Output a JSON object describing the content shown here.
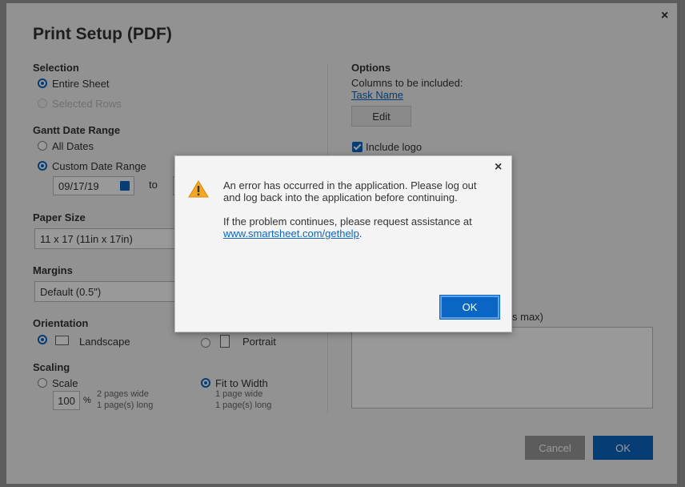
{
  "dialog": {
    "title": "Print Setup (PDF)",
    "selection": {
      "label": "Selection",
      "entire_sheet": "Entire Sheet",
      "selected_rows": "Selected Rows"
    },
    "gantt": {
      "label": "Gantt Date Range",
      "all_dates": "All Dates",
      "custom_range": "Custom Date Range",
      "start_date": "09/17/19",
      "to": "to"
    },
    "paper": {
      "label": "Paper Size",
      "value": "11 x 17 (11in x 17in)"
    },
    "margins": {
      "label": "Margins",
      "value": "Default (0.5\")"
    },
    "orientation": {
      "label": "Orientation",
      "landscape": "Landscape",
      "portrait": "Portrait"
    },
    "scaling": {
      "label": "Scaling",
      "scale": "Scale",
      "scale_value": "100",
      "percent": "%",
      "scale_wide": "2 pages wide",
      "scale_long": "1 page(s) long",
      "fit_width": "Fit to Width",
      "fit_wide": "1 page wide",
      "fit_long": "1 page(s) long"
    },
    "options": {
      "label": "Options",
      "columns_label": "Columns to be included:",
      "column_link": "Task Name",
      "edit": "Edit",
      "include_logo": "Include logo",
      "notes_fragment": "s max)"
    },
    "cancel": "Cancel",
    "ok": "OK",
    "close": "×"
  },
  "error": {
    "close": "×",
    "line1": "An error has occurred in the application. Please log out and log back into the application before continuing.",
    "line2_pre": "If the problem continues, please request assistance at ",
    "link": "www.smartsheet.com/gethelp",
    "line2_post": ".",
    "ok": "OK",
    "warning_icon": "⚠"
  },
  "colors": {
    "accent": "#0a66c2",
    "warning": "#f5a623"
  }
}
